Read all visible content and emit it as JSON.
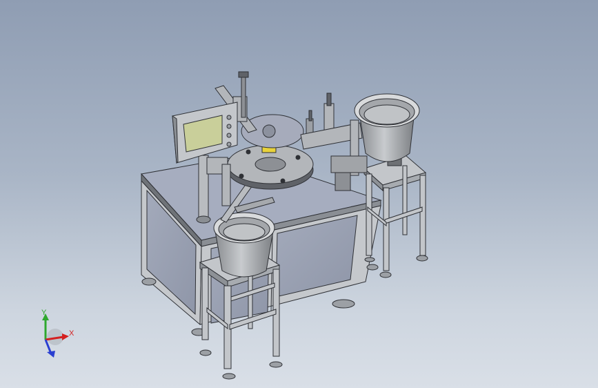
{
  "viewport": {
    "background_top": "#8f9db3",
    "background_bottom": "#d9dfe7"
  },
  "model": {
    "metal_color": "#b6b9bd",
    "panel_color": "#9ea5b8",
    "screen_color": "#c9cf9a",
    "accent_color": "#e8d23a"
  },
  "triad": {
    "x_label": "X",
    "y_label": "Y",
    "x_color": "#d42020",
    "y_color": "#2ea82e",
    "z_color": "#2a3fd1"
  }
}
